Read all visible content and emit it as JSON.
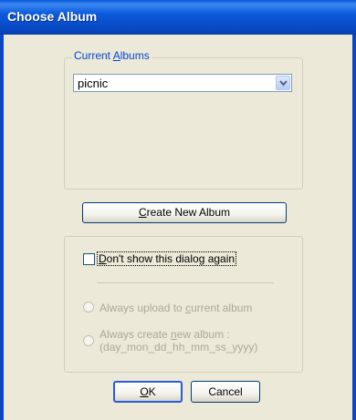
{
  "window": {
    "title": "Choose Album"
  },
  "current_albums": {
    "label_prefix": "Current ",
    "label_mnemonic": "A",
    "label_suffix": "lbums",
    "selected": "picnic"
  },
  "buttons": {
    "create_mnemonic": "C",
    "create_rest": "reate  New Album",
    "ok_mnemonic": "O",
    "ok_rest": "K",
    "cancel": "Cancel"
  },
  "options": {
    "dont_show_mnemonic": "D",
    "dont_show_rest": "on't show  this dialog again",
    "dont_show_checked": false,
    "radio1_prefix": "Always upload to ",
    "radio1_mnemonic": "c",
    "radio1_suffix": "urrent album",
    "radio2_prefix": "Always create ",
    "radio2_mnemonic": "n",
    "radio2_suffix": "ew album :",
    "radio2_line2": "(day_mon_dd_hh_mm_ss_yyyy)"
  },
  "colors": {
    "titlebar": "#0a58d8",
    "dialog_bg": "#ece9d8",
    "group_label": "#0046d5",
    "disabled_text": "#aca899"
  }
}
